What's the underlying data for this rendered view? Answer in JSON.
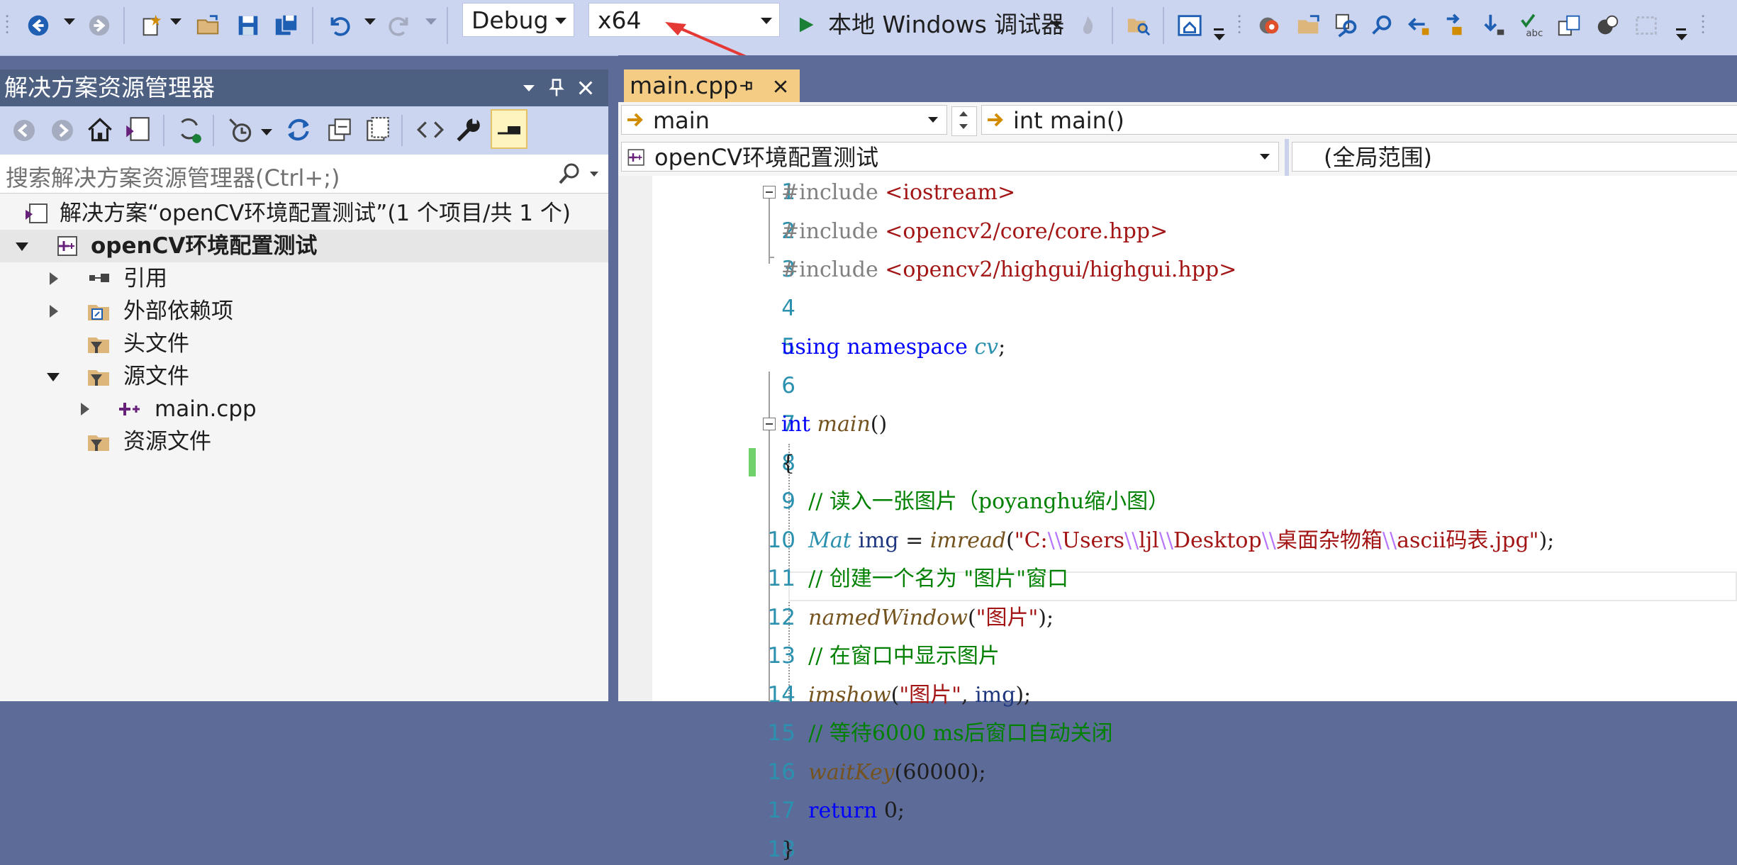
{
  "toolbar": {
    "config": "Debug",
    "platform": "x64",
    "debugger_label": "本地 Windows 调试器",
    "accent": "#1a7f37"
  },
  "solution_explorer": {
    "title": "解决方案资源管理器",
    "search_placeholder": "搜索解决方案资源管理器(Ctrl+;)",
    "solution_label": "解决方案“openCV环境配置测试”(1 个项目/共 1 个)",
    "project_label": "openCV环境配置测试",
    "items": [
      {
        "label": "引用"
      },
      {
        "label": "外部依赖项"
      },
      {
        "label": "头文件"
      },
      {
        "label": "源文件"
      },
      {
        "label": "main.cpp"
      },
      {
        "label": "资源文件"
      }
    ]
  },
  "editor": {
    "tab_label": "main.cpp",
    "nav_scope": "main",
    "nav_member": "int main()",
    "project_dropdown": "openCV环境配置测试",
    "scope_dropdown": "(全局范围)",
    "lines": [
      {
        "n": "1",
        "parts": [
          {
            "c": "pp",
            "t": "#include "
          },
          {
            "c": "inc",
            "t": "<iostream>"
          }
        ]
      },
      {
        "n": "2",
        "parts": [
          {
            "c": "pp",
            "t": "#include "
          },
          {
            "c": "inc",
            "t": "<opencv2/core/core.hpp>"
          }
        ]
      },
      {
        "n": "3",
        "parts": [
          {
            "c": "pp",
            "t": "#include "
          },
          {
            "c": "inc",
            "t": "<opencv2/highgui/highgui.hpp>"
          }
        ]
      },
      {
        "n": "4",
        "parts": []
      },
      {
        "n": "5",
        "parts": [
          {
            "c": "kw",
            "t": "using "
          },
          {
            "c": "kw",
            "t": "namespace "
          },
          {
            "c": "ns",
            "t": "cv"
          },
          {
            "c": "",
            "t": ";"
          }
        ]
      },
      {
        "n": "6",
        "parts": []
      },
      {
        "n": "7",
        "parts": [
          {
            "c": "kw",
            "t": "int "
          },
          {
            "c": "fn",
            "t": "main"
          },
          {
            "c": "",
            "t": "()"
          }
        ]
      },
      {
        "n": "8",
        "parts": [
          {
            "c": "",
            "t": "{"
          }
        ]
      },
      {
        "n": "9",
        "parts": [
          {
            "c": "cm",
            "t": "    // 读入一张图片（poyanghu缩小图）"
          }
        ]
      },
      {
        "n": "10",
        "parts": [
          {
            "c": "ty",
            "t": "    Mat "
          },
          {
            "c": "var",
            "t": "img "
          },
          {
            "c": "",
            "t": "= "
          },
          {
            "c": "fn",
            "t": "imread"
          },
          {
            "c": "",
            "t": "("
          },
          {
            "c": "str",
            "t": "\"C:"
          },
          {
            "c": "esc",
            "t": "\\\\"
          },
          {
            "c": "str",
            "t": "Users"
          },
          {
            "c": "esc",
            "t": "\\\\"
          },
          {
            "c": "str",
            "t": "ljl"
          },
          {
            "c": "esc",
            "t": "\\\\"
          },
          {
            "c": "str",
            "t": "Desktop"
          },
          {
            "c": "esc",
            "t": "\\\\"
          },
          {
            "c": "str",
            "t": "桌面杂物箱"
          },
          {
            "c": "esc",
            "t": "\\\\"
          },
          {
            "c": "str",
            "t": "ascii码表.jpg\""
          },
          {
            "c": "",
            "t": ");"
          }
        ]
      },
      {
        "n": "11",
        "parts": [
          {
            "c": "cm",
            "t": "    // 创建一个名为 \"图片\"窗口"
          }
        ]
      },
      {
        "n": "12",
        "parts": [
          {
            "c": "fn",
            "t": "    namedWindow"
          },
          {
            "c": "",
            "t": "("
          },
          {
            "c": "str",
            "t": "\"图片\""
          },
          {
            "c": "",
            "t": ");"
          }
        ]
      },
      {
        "n": "13",
        "parts": [
          {
            "c": "cm",
            "t": "    // 在窗口中显示图片"
          }
        ]
      },
      {
        "n": "14",
        "parts": [
          {
            "c": "fn",
            "t": "    imshow"
          },
          {
            "c": "",
            "t": "("
          },
          {
            "c": "str",
            "t": "\"图片\""
          },
          {
            "c": "",
            "t": ", "
          },
          {
            "c": "var",
            "t": "img"
          },
          {
            "c": "",
            "t": ");"
          }
        ]
      },
      {
        "n": "15",
        "parts": [
          {
            "c": "cm",
            "t": "    // 等待6000 ms后窗口自动关闭"
          }
        ]
      },
      {
        "n": "16",
        "parts": [
          {
            "c": "fn",
            "t": "    waitKey"
          },
          {
            "c": "",
            "t": "(60000);"
          }
        ]
      },
      {
        "n": "17",
        "parts": [
          {
            "c": "kw",
            "t": "    return "
          },
          {
            "c": "",
            "t": "0;"
          }
        ]
      },
      {
        "n": "18",
        "parts": [
          {
            "c": "",
            "t": "}"
          }
        ]
      }
    ]
  }
}
